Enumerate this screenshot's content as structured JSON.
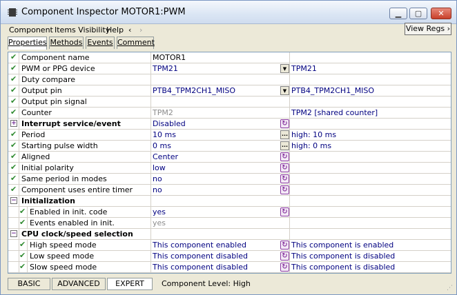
{
  "window": {
    "title": "Component Inspector MOTOR1:PWM"
  },
  "menu": {
    "component": "Component",
    "items_visibility": "Items Visibility",
    "help": "Help",
    "back": "‹",
    "forward": "›",
    "view_regs": "View Regs ›"
  },
  "tabs": [
    {
      "label": "Properties"
    },
    {
      "label": "Methods"
    },
    {
      "label": "Events"
    },
    {
      "label": "Comment"
    }
  ],
  "rows": [
    {
      "name": "Component name",
      "value": "MOTOR1",
      "info": "",
      "ctl": "none",
      "kind": "item",
      "sub": false,
      "val_style": "black"
    },
    {
      "name": "PWM or PPG device",
      "value": "TPM21",
      "info": "TPM21",
      "ctl": "dropdown",
      "kind": "item",
      "sub": false
    },
    {
      "name": "Duty compare",
      "value": "",
      "info": "",
      "ctl": "none",
      "kind": "item",
      "sub": false
    },
    {
      "name": "Output pin",
      "value": "PTB4_TPM2CH1_MISO",
      "info": "PTB4_TPM2CH1_MISO",
      "ctl": "dropdown",
      "kind": "item",
      "sub": false
    },
    {
      "name": "Output pin signal",
      "value": "",
      "info": "",
      "ctl": "none",
      "kind": "item",
      "sub": false
    },
    {
      "name": "Counter",
      "value": "TPM2",
      "info": "TPM2  [shared counter]",
      "ctl": "none",
      "kind": "item",
      "sub": false,
      "val_style": "gray"
    },
    {
      "name": "Interrupt service/event",
      "value": "Disabled",
      "info": "",
      "ctl": "reset",
      "kind": "group",
      "tree": "+"
    },
    {
      "name": "Period",
      "value": "10 ms",
      "info": "high: 10 ms",
      "ctl": "ellipsis",
      "kind": "item",
      "sub": false
    },
    {
      "name": "Starting pulse width",
      "value": "0 ms",
      "info": "high: 0 ms",
      "ctl": "ellipsis",
      "kind": "item",
      "sub": false
    },
    {
      "name": "Aligned",
      "value": "Center",
      "info": "",
      "ctl": "reset",
      "kind": "item",
      "sub": false
    },
    {
      "name": "Initial polarity",
      "value": "low",
      "info": "",
      "ctl": "reset",
      "kind": "item",
      "sub": false
    },
    {
      "name": "Same period in modes",
      "value": "no",
      "info": "",
      "ctl": "reset",
      "kind": "item",
      "sub": false
    },
    {
      "name": "Component uses entire timer",
      "value": "no",
      "info": "",
      "ctl": "reset",
      "kind": "item",
      "sub": false
    },
    {
      "name": "Initialization",
      "value": "",
      "info": "",
      "ctl": "none",
      "kind": "group",
      "tree": "−"
    },
    {
      "name": "Enabled in init. code",
      "value": "yes",
      "info": "",
      "ctl": "reset",
      "kind": "item",
      "sub": true
    },
    {
      "name": "Events enabled in init.",
      "value": "yes",
      "info": "",
      "ctl": "none",
      "kind": "item",
      "sub": true,
      "val_style": "gray"
    },
    {
      "name": "CPU clock/speed selection",
      "value": "",
      "info": "",
      "ctl": "none",
      "kind": "group",
      "tree": "−"
    },
    {
      "name": "High speed mode",
      "value": "This component enabled",
      "info": "This component is enabled",
      "ctl": "reset",
      "kind": "item",
      "sub": true
    },
    {
      "name": "Low speed mode",
      "value": "This component disabled",
      "info": "This component is disabled",
      "ctl": "reset",
      "kind": "item",
      "sub": true
    },
    {
      "name": "Slow speed mode",
      "value": "This component disabled",
      "info": "This component is disabled",
      "ctl": "reset",
      "kind": "item",
      "sub": true
    }
  ],
  "bottom": {
    "basic": "BASIC",
    "advanced": "ADVANCED",
    "expert": "EXPERT",
    "level": "Component Level: High"
  },
  "colors": {
    "value_text": "#000080",
    "check": "#2f8a2f",
    "reset_icon": "#8a3aa0"
  }
}
